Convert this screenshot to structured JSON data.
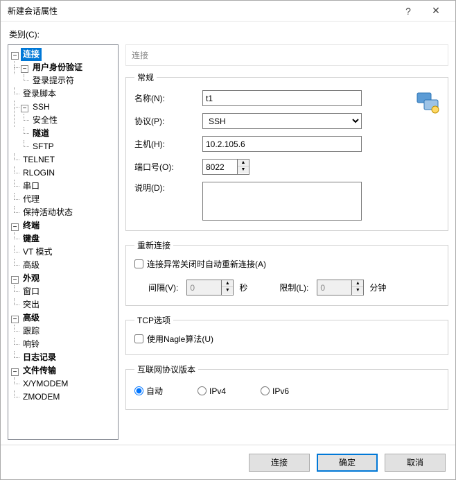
{
  "dialog": {
    "title": "新建会话属性",
    "help_icon": "?",
    "close_icon": "✕"
  },
  "category_label": "类别(C):",
  "tree": {
    "connection": "连接",
    "auth": "用户身份验证",
    "login_prompt": "登录提示符",
    "login_script": "登录脚本",
    "ssh": "SSH",
    "security": "安全性",
    "tunnel": "隧道",
    "sftp": "SFTP",
    "telnet": "TELNET",
    "rlogin": "RLOGIN",
    "serial": "串口",
    "proxy": "代理",
    "keepalive": "保持活动状态",
    "terminal": "终端",
    "keyboard": "键盘",
    "vt": "VT 模式",
    "advanced_term": "高级",
    "appearance": "外观",
    "window": "窗口",
    "highlight": "突出",
    "advanced": "高级",
    "trace": "跟踪",
    "bell": "响铃",
    "logging": "日志记录",
    "filetransfer": "文件传输",
    "xymodem": "X/YMODEM",
    "zmodem": "ZMODEM"
  },
  "panel_title": "连接",
  "general": {
    "legend": "常规",
    "name_label": "名称(N):",
    "name_value": "t1",
    "protocol_label": "协议(P):",
    "protocol_value": "SSH",
    "host_label": "主机(H):",
    "host_value": "10.2.105.6",
    "port_label": "端口号(O):",
    "port_value": "8022",
    "desc_label": "说明(D):",
    "desc_value": ""
  },
  "reconnect": {
    "legend": "重新连接",
    "checkbox_label": "连接异常关闭时自动重新连接(A)",
    "interval_label": "间隔(V):",
    "interval_value": "0",
    "interval_unit": "秒",
    "limit_label": "限制(L):",
    "limit_value": "0",
    "limit_unit": "分钟"
  },
  "tcp": {
    "legend": "TCP选项",
    "nagle_label": "使用Nagle算法(U)"
  },
  "ipver": {
    "legend": "互联网协议版本",
    "auto": "自动",
    "ipv4": "IPv4",
    "ipv6": "IPv6"
  },
  "buttons": {
    "connect": "连接",
    "ok": "确定",
    "cancel": "取消"
  }
}
